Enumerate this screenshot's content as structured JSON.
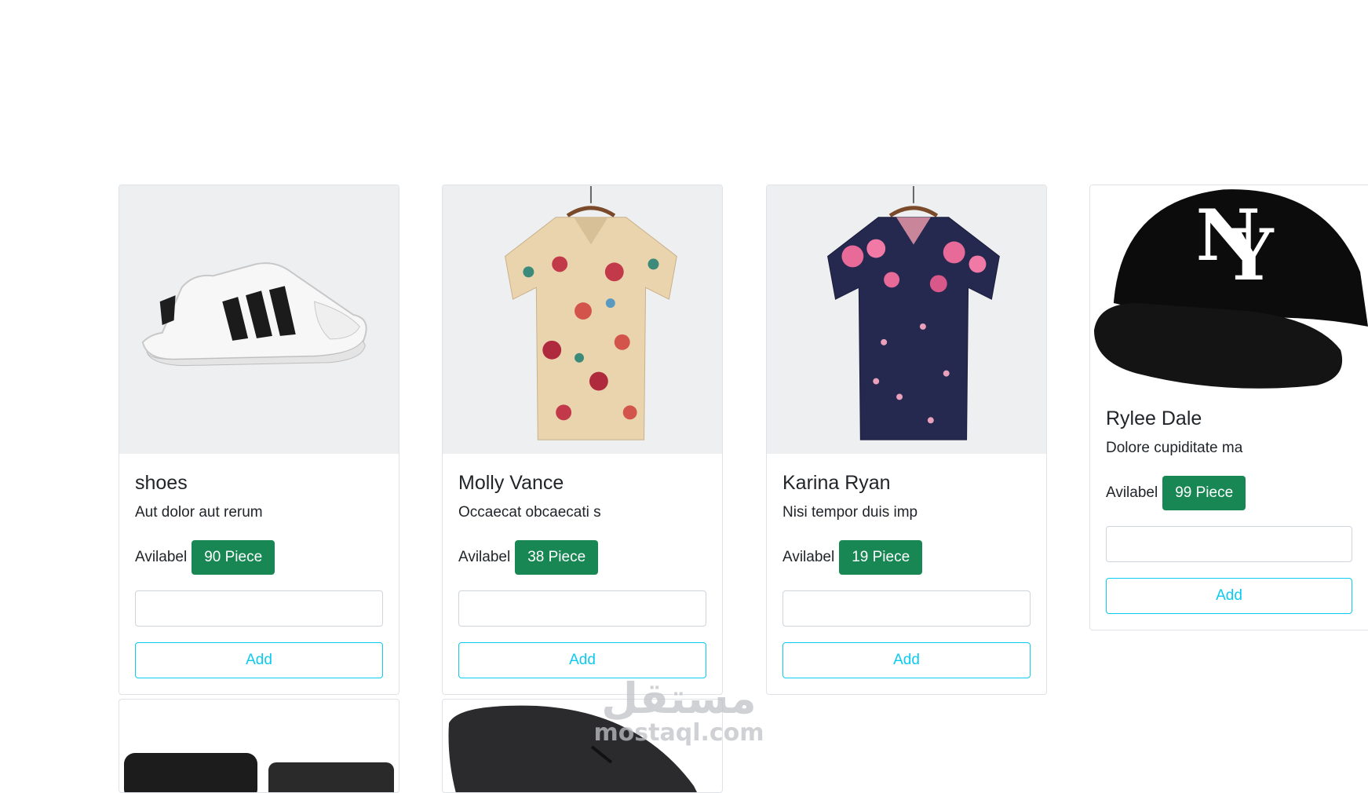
{
  "products": [
    {
      "title": "shoes",
      "description": "Aut dolor aut rerum",
      "available_label": "Avilabel",
      "stock": "90 Piece",
      "quantity_value": "",
      "add_label": "Add"
    },
    {
      "title": "Molly Vance",
      "description": "Occaecat obcaecati s",
      "available_label": "Avilabel",
      "stock": "38 Piece",
      "quantity_value": "",
      "add_label": "Add"
    },
    {
      "title": "Karina Ryan",
      "description": "Nisi tempor duis imp",
      "available_label": "Avilabel",
      "stock": "19 Piece",
      "quantity_value": "",
      "add_label": "Add"
    },
    {
      "title": "Rylee Dale",
      "description": "Dolore cupiditate ma",
      "available_label": "Avilabel",
      "stock": "99 Piece",
      "quantity_value": "",
      "add_label": "Add"
    }
  ],
  "watermark": {
    "arabic": "مستقل",
    "latin": "mostaql.com"
  },
  "colors": {
    "badge": "#198754",
    "add_button": "#0dcaf0",
    "card_border": "#dfe2e6",
    "image_bg": "#eeeff1"
  },
  "icons": [
    "sneaker-image",
    "floral-shirt-image",
    "navy-floral-shirt-image",
    "baseball-cap-image",
    "camera-image",
    "mouse-image"
  ]
}
